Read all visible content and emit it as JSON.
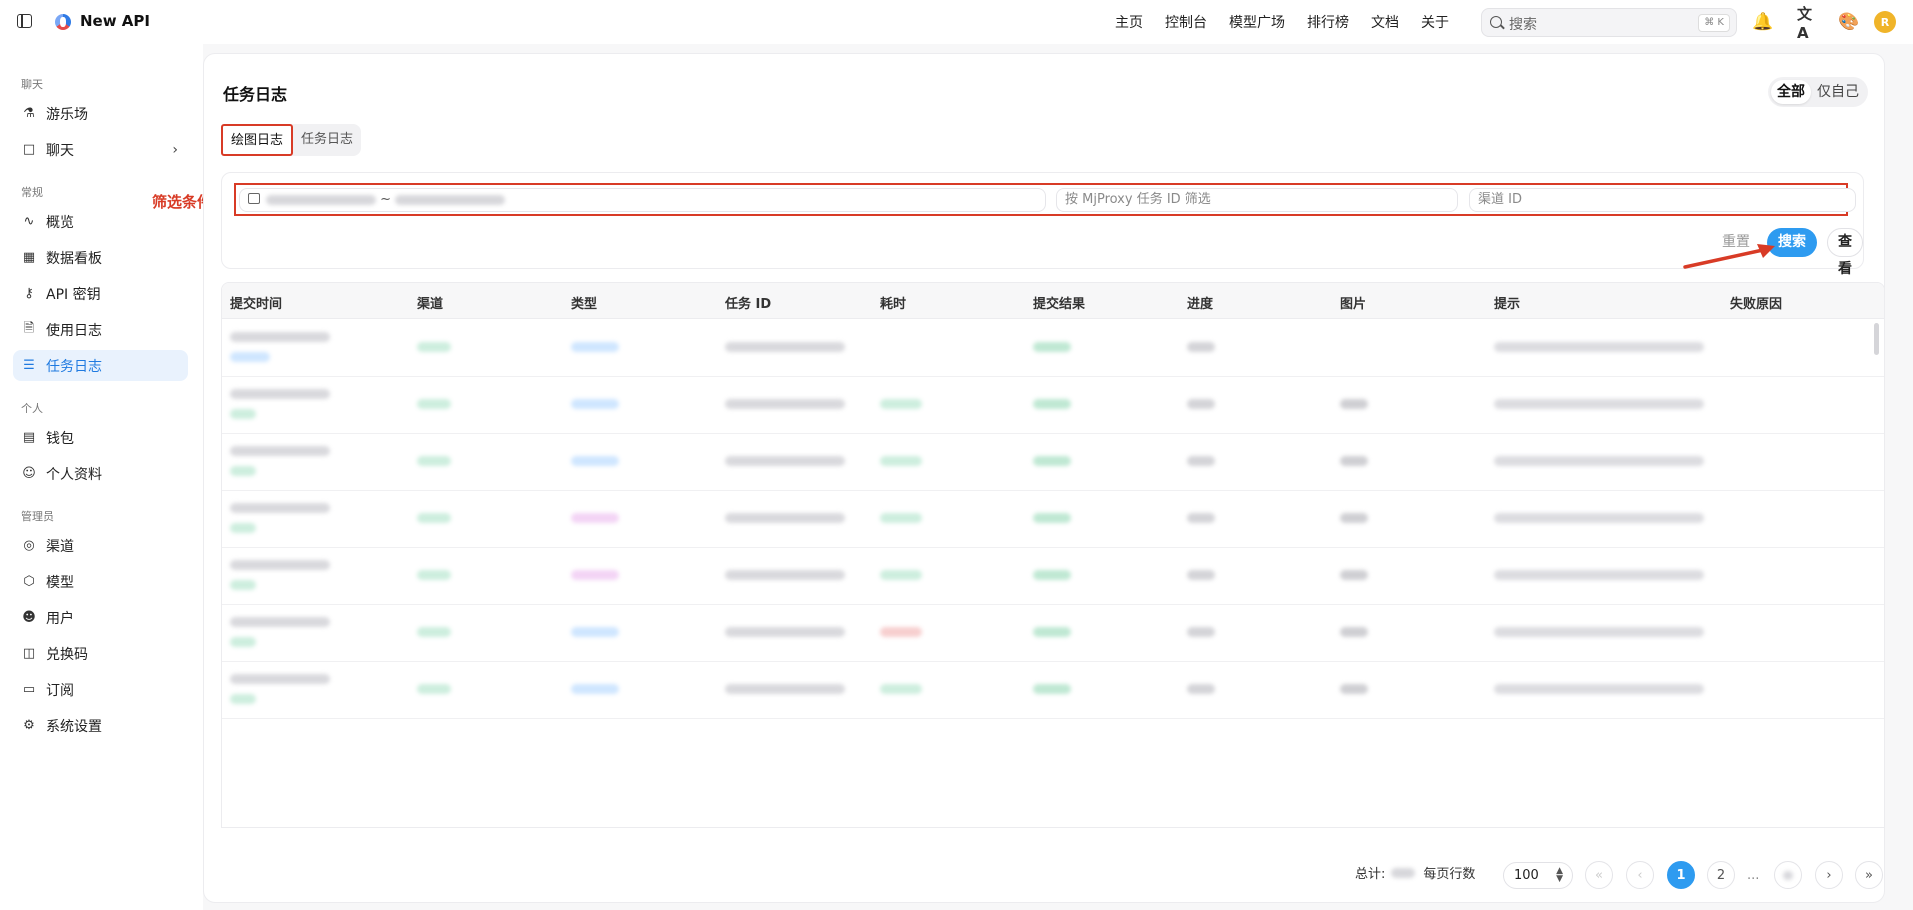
{
  "app": {
    "title": "New API",
    "brand_color": "#2e9bf0"
  },
  "nav": {
    "items": [
      "主页",
      "控制台",
      "模型广场",
      "排行榜",
      "文档",
      "关于"
    ]
  },
  "search": {
    "placeholder": "搜索",
    "shortcut": "⌘ K"
  },
  "user": {
    "avatar_letter": "R"
  },
  "sidebar": {
    "sections": [
      {
        "title": "聊天",
        "items": [
          {
            "label": "游乐场",
            "icon": "flask-icon"
          },
          {
            "label": "聊天",
            "icon": "message-icon",
            "has_children": true
          }
        ]
      },
      {
        "title": "常规",
        "items": [
          {
            "label": "概览",
            "icon": "activity-icon"
          },
          {
            "label": "数据看板",
            "icon": "grid-icon"
          },
          {
            "label": "API 密钥",
            "icon": "key-icon"
          },
          {
            "label": "使用日志",
            "icon": "file-icon"
          },
          {
            "label": "任务日志",
            "icon": "list-icon",
            "active": true
          }
        ]
      },
      {
        "title": "个人",
        "items": [
          {
            "label": "钱包",
            "icon": "wallet-icon"
          },
          {
            "label": "个人资料",
            "icon": "user-icon"
          }
        ]
      },
      {
        "title": "管理员",
        "items": [
          {
            "label": "渠道",
            "icon": "signal-icon"
          },
          {
            "label": "模型",
            "icon": "cube-icon"
          },
          {
            "label": "用户",
            "icon": "users-icon"
          },
          {
            "label": "兑换码",
            "icon": "ticket-icon"
          },
          {
            "label": "订阅",
            "icon": "card-icon"
          },
          {
            "label": "系统设置",
            "icon": "gear-icon"
          }
        ]
      }
    ]
  },
  "page": {
    "title": "任务日志",
    "scope": {
      "all": "全部",
      "self": "仅自己",
      "selected": "全部"
    },
    "tabs": [
      {
        "label": "绘图日志",
        "active": true
      },
      {
        "label": "任务日志",
        "active": false
      }
    ],
    "annotation": "筛选条件",
    "filters": {
      "date_separator": "~",
      "mj_placeholder": "按 MjProxy 任务 ID 筛选",
      "channel_placeholder": "渠道 ID"
    },
    "buttons": {
      "reset": "重置",
      "search": "搜索",
      "view": "查看"
    }
  },
  "table": {
    "columns": [
      "提交时间",
      "渠道",
      "类型",
      "任务 ID",
      "耗时",
      "提交结果",
      "进度",
      "图片",
      "提示",
      "失败原因"
    ]
  },
  "pagination": {
    "total_label": "总计:",
    "page_size_label": "每页行数",
    "page_size": "100",
    "pages": [
      "1",
      "2"
    ],
    "ellipsis": "...",
    "current": "1"
  }
}
